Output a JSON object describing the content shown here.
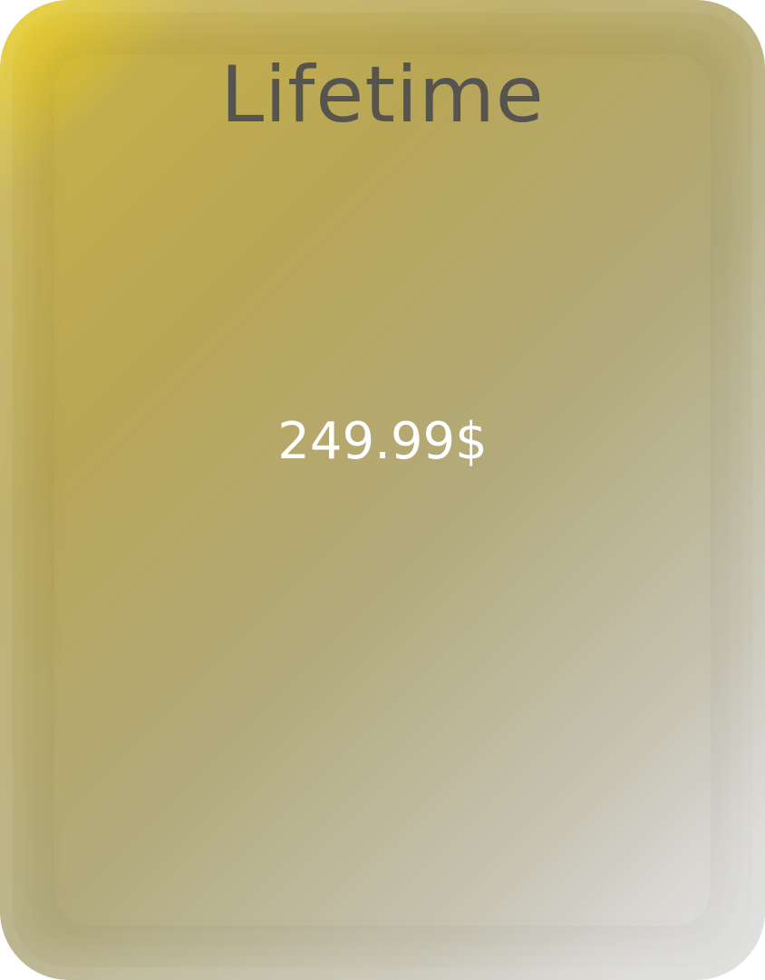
{
  "plan": {
    "title": "Lifetime",
    "price": "249.99$"
  },
  "colors": {
    "gradient_start": "#f2d313",
    "gradient_mid": "#b8a657",
    "gradient_end": "#e2e2e0",
    "title_text": "#55544f",
    "price_text": "#ffffff"
  }
}
